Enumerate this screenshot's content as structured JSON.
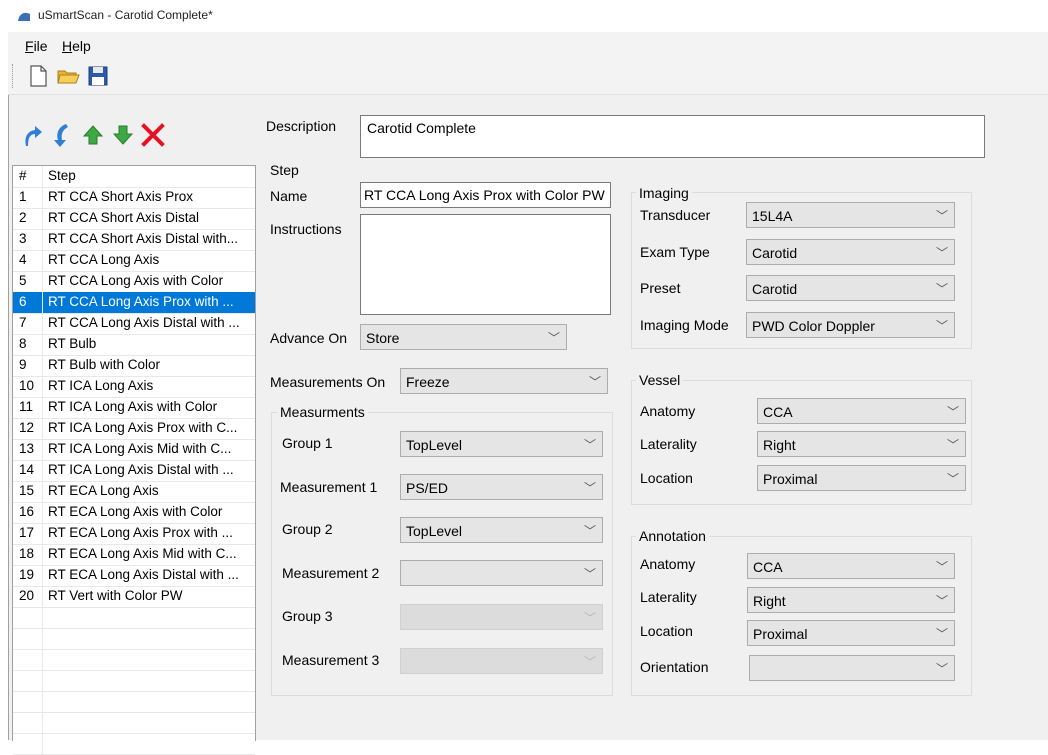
{
  "window": {
    "title": "uSmartScan - Carotid Complete*"
  },
  "menu": {
    "file": "File",
    "file_key": "F",
    "file_rest": "ile",
    "help": "Help",
    "help_key": "H",
    "help_rest": "elp"
  },
  "toolbar": {
    "new_icon": "new-file-icon",
    "open_icon": "open-folder-icon",
    "save_icon": "save-disk-icon"
  },
  "description": {
    "label": "Description",
    "value": "Carotid Complete"
  },
  "step_list": {
    "header_num": "#",
    "header_label": "Step",
    "selected_index": 6,
    "rows": [
      {
        "num": "1",
        "label": "RT CCA Short Axis Prox"
      },
      {
        "num": "2",
        "label": "RT CCA Short Axis Distal"
      },
      {
        "num": "3",
        "label": "RT CCA Short Axis Distal with..."
      },
      {
        "num": "4",
        "label": "RT CCA Long Axis"
      },
      {
        "num": "5",
        "label": "RT CCA Long Axis with Color"
      },
      {
        "num": "6",
        "label": "RT CCA Long Axis Prox with ..."
      },
      {
        "num": "7",
        "label": "RT CCA Long Axis Distal with ..."
      },
      {
        "num": "8",
        "label": "RT Bulb"
      },
      {
        "num": "9",
        "label": "RT Bulb with Color"
      },
      {
        "num": "10",
        "label": "RT ICA Long Axis"
      },
      {
        "num": "11",
        "label": "RT ICA Long Axis with Color"
      },
      {
        "num": "12",
        "label": "RT ICA Long Axis Prox with C..."
      },
      {
        "num": "13",
        "label": "RT ICA Long Axis Mid with C..."
      },
      {
        "num": "14",
        "label": "RT ICA Long Axis Distal with ..."
      },
      {
        "num": "15",
        "label": "RT ECA Long Axis"
      },
      {
        "num": "16",
        "label": "RT ECA Long Axis with Color"
      },
      {
        "num": "17",
        "label": "RT ECA Long Axis Prox with ..."
      },
      {
        "num": "18",
        "label": "RT ECA Long Axis Mid with C..."
      },
      {
        "num": "19",
        "label": "RT ECA Long Axis Distal with ..."
      },
      {
        "num": "20",
        "label": "RT Vert with Color PW"
      }
    ]
  },
  "step": {
    "group_title": "Step",
    "name_label": "Name",
    "name_value": "RT CCA Long Axis Prox with Color PW",
    "instructions_label": "Instructions",
    "instructions_value": "",
    "advance_on_label": "Advance On",
    "advance_on_value": "Store",
    "measurements_on_label": "Measurements On",
    "measurements_on_value": "Freeze"
  },
  "measurements": {
    "group_title": "Measurments",
    "group1_label": "Group 1",
    "group1_value": "TopLevel",
    "meas1_label": "Measurement 1",
    "meas1_value": "PS/ED",
    "group2_label": "Group 2",
    "group2_value": "TopLevel",
    "meas2_label": "Measurement 2",
    "meas2_value": "",
    "group3_label": "Group 3",
    "group3_value": "",
    "meas3_label": "Measurement 3",
    "meas3_value": ""
  },
  "imaging": {
    "group_title": "Imaging",
    "transducer_label": "Transducer",
    "transducer_value": "15L4A",
    "exam_type_label": "Exam Type",
    "exam_type_value": "Carotid",
    "preset_label": "Preset",
    "preset_value": "Carotid",
    "mode_label": "Imaging Mode",
    "mode_value": "PWD Color Doppler"
  },
  "vessel": {
    "group_title": "Vessel",
    "anatomy_label": "Anatomy",
    "anatomy_value": "CCA",
    "laterality_label": "Laterality",
    "laterality_value": "Right",
    "location_label": "Location",
    "location_value": "Proximal"
  },
  "annotation": {
    "group_title": "Annotation",
    "anatomy_label": "Anatomy",
    "anatomy_value": "CCA",
    "laterality_label": "Laterality",
    "laterality_value": "Right",
    "location_label": "Location",
    "location_value": "Proximal",
    "orientation_label": "Orientation",
    "orientation_value": ""
  },
  "colors": {
    "selection": "#0078d7",
    "panel": "#f0f0f0",
    "delete": "#e81123",
    "arrow_blue": "#2f7fd6",
    "arrow_green": "#3ea843"
  }
}
